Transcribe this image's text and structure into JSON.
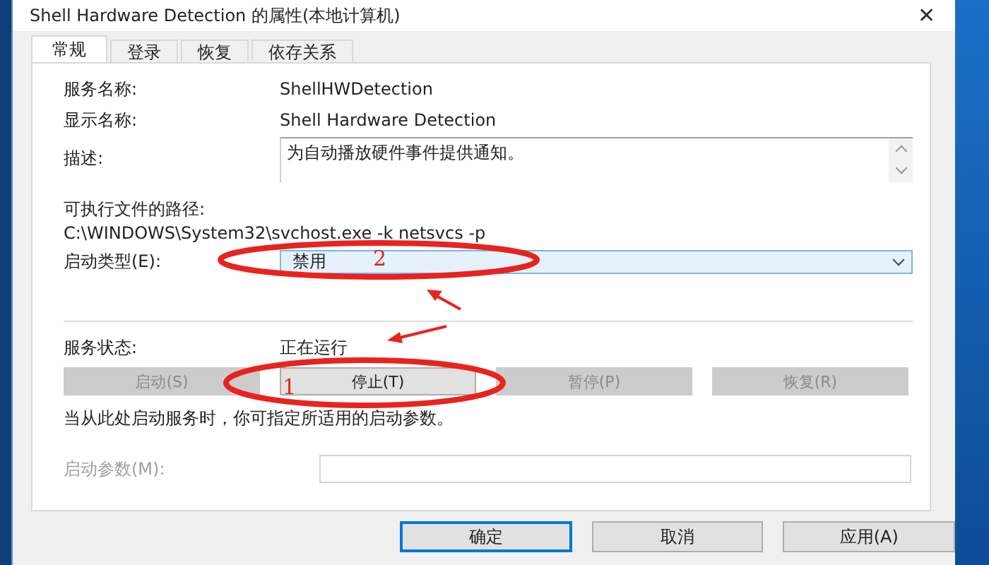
{
  "window": {
    "title": "Shell Hardware Detection 的属性(本地计算机)",
    "close": "✕"
  },
  "tabs": [
    {
      "label": "常规",
      "selected": true
    },
    {
      "label": "登录",
      "selected": false
    },
    {
      "label": "恢复",
      "selected": false
    },
    {
      "label": "依存关系",
      "selected": false
    }
  ],
  "service_name": {
    "label": "服务名称:",
    "value": "ShellHWDetection"
  },
  "display_name": {
    "label": "显示名称:",
    "value": "Shell Hardware Detection"
  },
  "description": {
    "label": "描述:",
    "value": "为自动播放硬件事件提供通知。"
  },
  "executable_path": {
    "label": "可执行文件的路径:",
    "value": "C:\\WINDOWS\\System32\\svchost.exe -k netsvcs -p"
  },
  "startup_type": {
    "label": "启动类型(E):",
    "value": "禁用"
  },
  "service_status": {
    "label": "服务状态:",
    "value": "正在运行"
  },
  "service_buttons": [
    {
      "label": "启动(S)",
      "disabled": true
    },
    {
      "label": "停止(T)",
      "disabled": false
    },
    {
      "label": "暂停(P)",
      "disabled": true
    },
    {
      "label": "恢复(R)",
      "disabled": true
    }
  ],
  "hint": "当从此处启动服务时，你可指定所适用的启动参数。",
  "start_parameters": {
    "label": "启动参数(M):",
    "disabled": true
  },
  "dialog_buttons": [
    {
      "label": "确定",
      "default": true
    },
    {
      "label": "取消",
      "default": false
    },
    {
      "label": "应用(A)",
      "default": false
    }
  ],
  "annotation_labels": [
    "2",
    "1"
  ]
}
